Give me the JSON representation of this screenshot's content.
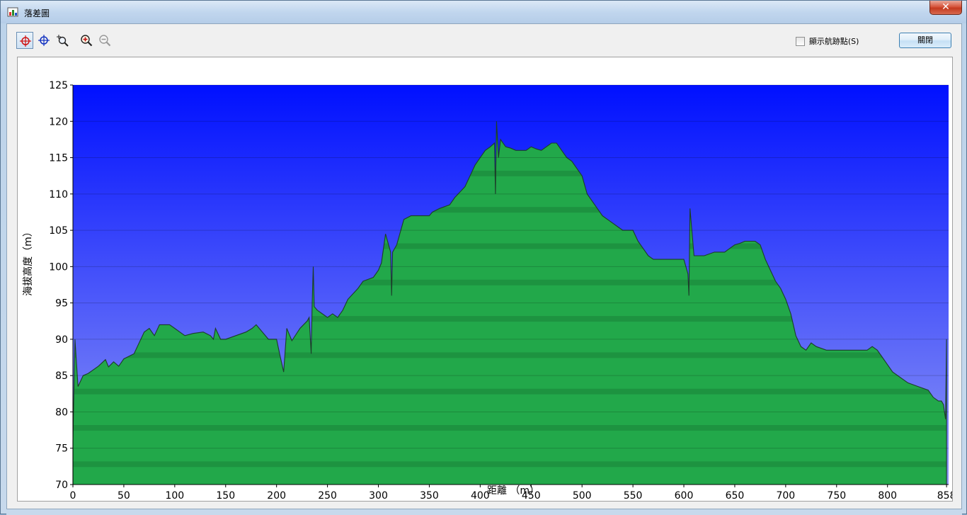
{
  "window": {
    "title": "落差圖",
    "close_glyph": "✕"
  },
  "toolbar": {
    "tools": [
      {
        "name": "crosshair-red-icon",
        "active": true
      },
      {
        "name": "crosshair-blue-icon",
        "active": false
      },
      {
        "name": "zoom-region-icon",
        "active": false
      },
      {
        "name": "zoom-in-icon",
        "active": false
      },
      {
        "name": "zoom-out-icon",
        "active": false
      }
    ],
    "show_waypoints_label": "顯示航跡點(S)",
    "show_waypoints_checked": false,
    "close_label": "關閉"
  },
  "colors": {
    "sky_top": "#0010ff",
    "sky_bottom": "#8f98f5",
    "terrain": "#22a84a",
    "terrain_dark": "#177a34",
    "line": "#1c3d2a"
  },
  "chart_data": {
    "type": "area",
    "xlabel": "距離 （m）",
    "ylabel": "海拔高度（m）",
    "xlim": [
      0,
      860
    ],
    "ylim": [
      70,
      125
    ],
    "xticks": [
      0,
      50,
      100,
      150,
      200,
      250,
      300,
      350,
      400,
      450,
      500,
      550,
      600,
      650,
      700,
      750,
      800,
      858
    ],
    "yticks": [
      70,
      75,
      80,
      85,
      90,
      95,
      100,
      105,
      110,
      115,
      120,
      125
    ],
    "grid": true,
    "series": [
      {
        "x": [
          0,
          2,
          5,
          10,
          15,
          25,
          32,
          35,
          40,
          45,
          50,
          60,
          70,
          75,
          80,
          85,
          95,
          100,
          105,
          110,
          118,
          128,
          135,
          138,
          140,
          145,
          150,
          160,
          170,
          176,
          180,
          192,
          196,
          200,
          203,
          207,
          210,
          215,
          223,
          230,
          232,
          234,
          235,
          236,
          237,
          240,
          245,
          250,
          255,
          260,
          265,
          270,
          280,
          285,
          295,
          300,
          303,
          307,
          312,
          313,
          314,
          318,
          325,
          332,
          345,
          350,
          353,
          360,
          370,
          375,
          385,
          390,
          395,
          400,
          405,
          410,
          414,
          415,
          416,
          418,
          420,
          425,
          430,
          435,
          440,
          445,
          450,
          455,
          460,
          465,
          470,
          475,
          480,
          485,
          490,
          495,
          500,
          505,
          510,
          515,
          520,
          525,
          530,
          535,
          540,
          545,
          550,
          555,
          560,
          565,
          570,
          575,
          580,
          590,
          600,
          604,
          605,
          606,
          610,
          620,
          630,
          635,
          640,
          645,
          650,
          655,
          660,
          665,
          670,
          675,
          680,
          685,
          690,
          695,
          700,
          705,
          710,
          715,
          720,
          725,
          730,
          740,
          750,
          760,
          770,
          780,
          785,
          790,
          795,
          800,
          805,
          810,
          820,
          830,
          840,
          845,
          850,
          853,
          855,
          856,
          857,
          858
        ],
        "y": [
          76,
          90,
          83.5,
          85,
          85.3,
          86.3,
          87.2,
          86.2,
          86.9,
          86.3,
          87.3,
          88,
          91,
          91.5,
          90.5,
          92,
          92,
          91.5,
          91,
          90.5,
          90.8,
          91,
          90.5,
          90,
          91.5,
          90,
          90,
          90.5,
          91,
          91.5,
          92,
          90,
          90,
          90,
          88,
          85.5,
          91.5,
          89.8,
          91.5,
          92.5,
          93,
          88,
          95,
          100,
          94.5,
          94,
          93.5,
          93,
          93.5,
          93,
          94,
          95.5,
          97,
          98,
          98.5,
          99.5,
          100.5,
          104.5,
          102,
          96,
          102,
          103,
          106.5,
          107,
          107,
          107,
          107.5,
          108,
          108.5,
          109.5,
          111,
          112.5,
          114,
          115,
          116,
          116.5,
          117,
          110,
          120,
          115,
          117.5,
          116.5,
          116.3,
          116,
          116,
          116,
          116.5,
          116.2,
          116,
          116.5,
          117,
          117,
          116,
          115,
          114.5,
          113.5,
          112.5,
          110,
          109,
          108,
          107,
          106.5,
          106,
          105.5,
          105,
          105,
          105,
          103.5,
          102.5,
          101.5,
          101,
          101,
          101,
          101,
          101,
          99,
          96,
          108,
          101.5,
          101.5,
          102,
          102,
          102,
          102.5,
          103,
          103.2,
          103.5,
          103.5,
          103.5,
          103,
          101,
          99.5,
          98,
          97,
          95.5,
          93.5,
          90.5,
          89,
          88.5,
          89.5,
          89,
          88.5,
          88.5,
          88.5,
          88.5,
          88.5,
          89,
          88.5,
          87.5,
          86.5,
          85.5,
          85,
          84,
          83.5,
          83,
          82,
          81.5,
          81.5,
          81,
          80,
          79,
          90
        ]
      }
    ]
  }
}
